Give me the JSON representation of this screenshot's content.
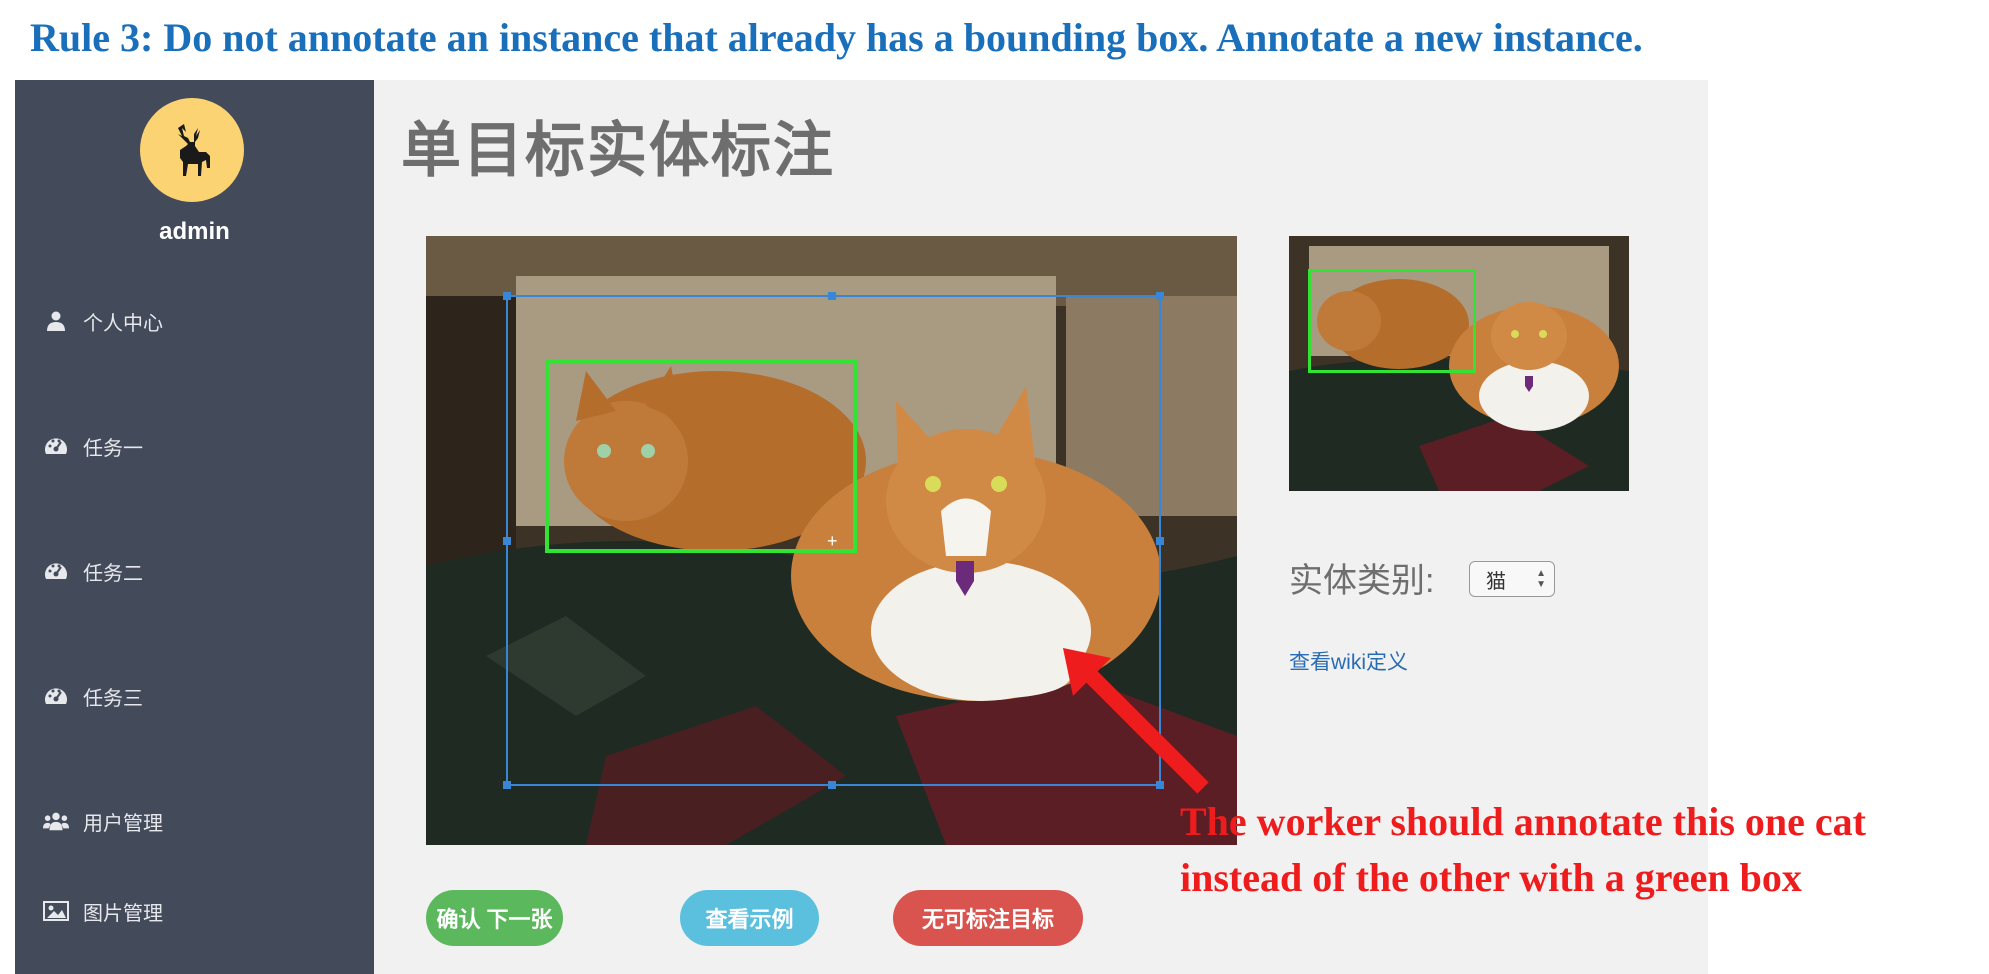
{
  "rule_caption": "Rule 3: Do not annotate an instance that already has a bounding box. Annotate a new instance.",
  "sidebar": {
    "avatar_icon": "elk-icon",
    "username": "admin",
    "items": [
      {
        "label": "个人中心",
        "icon": "user-icon"
      },
      {
        "label": "任务一",
        "icon": "dashboard-icon"
      },
      {
        "label": "任务二",
        "icon": "dashboard-icon"
      },
      {
        "label": "任务三",
        "icon": "dashboard-icon"
      },
      {
        "label": "用户管理",
        "icon": "users-icon"
      },
      {
        "label": "图片管理",
        "icon": "image-icon"
      }
    ],
    "background": "#434a5a",
    "avatar_color": "#fcd373"
  },
  "main": {
    "title": "单目标实体标注",
    "category_label": "实体类别:",
    "category_value": "猫",
    "wiki_link": "查看wiki定义",
    "buttons": {
      "confirm": "确认 下一张",
      "example": "查看示例",
      "none": "无可标注目标"
    }
  },
  "annotation": {
    "note_line1": "The worker should annotate this one cat",
    "note_line2": "instead of the other with a green box"
  },
  "colors": {
    "caption": "#1a6fba",
    "existing_box": "#33e333",
    "selection_box": "#3a86d6",
    "confirm": "#5cb85c",
    "example": "#5bc0de",
    "none": "#d9534f",
    "note": "#ee1c1c"
  }
}
